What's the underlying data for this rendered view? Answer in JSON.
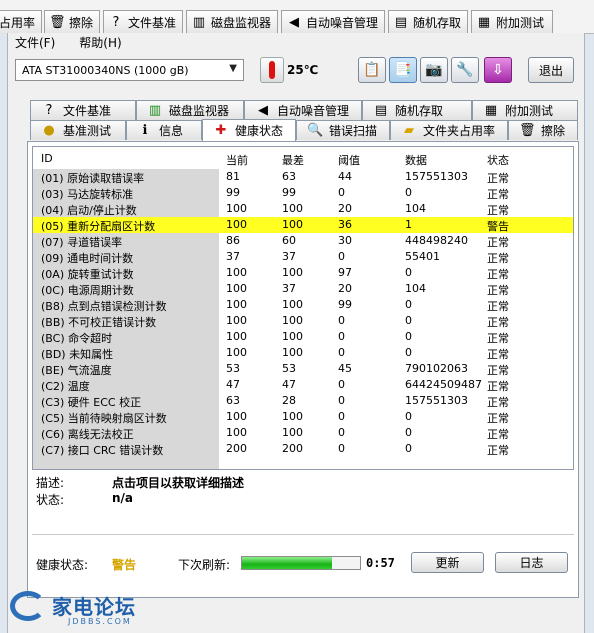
{
  "outer_tabs": [
    {
      "label": "占用率",
      "icon": "none"
    },
    {
      "label": "擦除",
      "icon": "trash-icon"
    },
    {
      "label": "文件基准",
      "icon": "file-benchmark-icon"
    },
    {
      "label": "磁盘监视器",
      "icon": "chart-icon"
    },
    {
      "label": "自动噪音管理",
      "icon": "speaker-icon"
    },
    {
      "label": "随机存取",
      "icon": "random-access-icon"
    },
    {
      "label": "附加测试",
      "icon": "extra-tests-icon"
    }
  ],
  "menu": {
    "file": "文件(F)",
    "help": "帮助(H)"
  },
  "toolbar": {
    "drive": "ATA    ST31000340NS (1000 gB)",
    "temperature": "25℃",
    "exit_label": "退出"
  },
  "tabs_row1": [
    {
      "label": "文件基准",
      "icon": "file-benchmark-icon"
    },
    {
      "label": "磁盘监视器",
      "icon": "chart-icon"
    },
    {
      "label": "自动噪音管理",
      "icon": "speaker-icon"
    },
    {
      "label": "随机存取",
      "icon": "random-access-icon"
    },
    {
      "label": "附加测试",
      "icon": "extra-tests-icon"
    }
  ],
  "tabs_row2": [
    {
      "label": "基准测试",
      "icon": "benchmark-icon"
    },
    {
      "label": "信息",
      "icon": "info-icon"
    },
    {
      "label": "健康状态",
      "icon": "health-icon",
      "active": true
    },
    {
      "label": "错误扫描",
      "icon": "magnifier-icon"
    },
    {
      "label": "文件夹占用率",
      "icon": "folder-icon"
    },
    {
      "label": "擦除",
      "icon": "trash-icon"
    }
  ],
  "smart_table": {
    "headers": [
      "ID",
      "当前",
      "最差",
      "阈值",
      "数据",
      "状态"
    ],
    "rows": [
      {
        "id": "(01) 原始读取错误率",
        "cur": "81",
        "worst": "63",
        "thr": "44",
        "data": "157551303",
        "status": "正常"
      },
      {
        "id": "(03) 马达旋转标准",
        "cur": "99",
        "worst": "99",
        "thr": "0",
        "data": "0",
        "status": "正常"
      },
      {
        "id": "(04) 启动/停止计数",
        "cur": "100",
        "worst": "100",
        "thr": "20",
        "data": "104",
        "status": "正常"
      },
      {
        "id": "(05) 重新分配扇区计数",
        "cur": "100",
        "worst": "100",
        "thr": "36",
        "data": "1",
        "status": "警告",
        "warn": true
      },
      {
        "id": "(07) 寻道错误率",
        "cur": "86",
        "worst": "60",
        "thr": "30",
        "data": "448498240",
        "status": "正常"
      },
      {
        "id": "(09) 通电时间计数",
        "cur": "37",
        "worst": "37",
        "thr": "0",
        "data": "55401",
        "status": "正常"
      },
      {
        "id": "(0A) 旋转重试计数",
        "cur": "100",
        "worst": "100",
        "thr": "97",
        "data": "0",
        "status": "正常"
      },
      {
        "id": "(0C) 电源周期计数",
        "cur": "100",
        "worst": "37",
        "thr": "20",
        "data": "104",
        "status": "正常"
      },
      {
        "id": "(B8) 点到点错误检测计数",
        "cur": "100",
        "worst": "100",
        "thr": "99",
        "data": "0",
        "status": "正常"
      },
      {
        "id": "(BB) 不可校正错误计数",
        "cur": "100",
        "worst": "100",
        "thr": "0",
        "data": "0",
        "status": "正常"
      },
      {
        "id": "(BC) 命令超时",
        "cur": "100",
        "worst": "100",
        "thr": "0",
        "data": "0",
        "status": "正常"
      },
      {
        "id": "(BD) 未知属性",
        "cur": "100",
        "worst": "100",
        "thr": "0",
        "data": "0",
        "status": "正常"
      },
      {
        "id": "(BE) 气流温度",
        "cur": "53",
        "worst": "53",
        "thr": "45",
        "data": "790102063",
        "status": "正常"
      },
      {
        "id": "(C2) 温度",
        "cur": "47",
        "worst": "47",
        "thr": "0",
        "data": "64424509487",
        "status": "正常"
      },
      {
        "id": "(C3) 硬件 ECC 校正",
        "cur": "63",
        "worst": "28",
        "thr": "0",
        "data": "157551303",
        "status": "正常"
      },
      {
        "id": "(C5) 当前待映射扇区计数",
        "cur": "100",
        "worst": "100",
        "thr": "0",
        "data": "0",
        "status": "正常"
      },
      {
        "id": "(C6) 离线无法校正",
        "cur": "100",
        "worst": "100",
        "thr": "0",
        "data": "0",
        "status": "正常"
      },
      {
        "id": "(C7) 接口 CRC 错误计数",
        "cur": "200",
        "worst": "200",
        "thr": "0",
        "data": "0",
        "status": "正常"
      }
    ]
  },
  "description": {
    "label": "描述:",
    "value": "点击项目以获取详细描述"
  },
  "state": {
    "label": "状态:",
    "value": "n/a"
  },
  "health": {
    "label": "健康状态:",
    "value": "警告"
  },
  "refresh": {
    "label": "下次刷新:",
    "timer": "0:57",
    "progress": 0.76
  },
  "buttons": {
    "update": "更新",
    "log": "日志"
  },
  "watermark": {
    "title": "家电论坛",
    "sub": "JDBBS.COM"
  },
  "colors": {
    "warn_row": "#ffff22",
    "warn_text": "#d4a600",
    "progress": "#18b418"
  }
}
